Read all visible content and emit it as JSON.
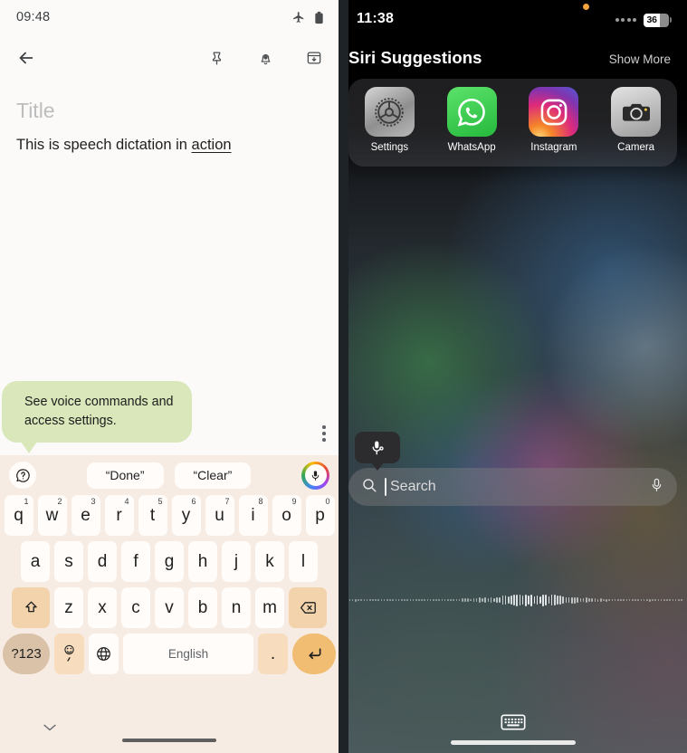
{
  "left": {
    "status": {
      "time": "09:48",
      "icons": [
        "airplane-mode-icon",
        "battery-icon"
      ]
    },
    "toolbar": {
      "back_label": "Back",
      "actions": [
        "pin-icon",
        "reminder-bell-icon",
        "archive-icon"
      ]
    },
    "note": {
      "title_placeholder": "Title",
      "body_prefix": "This is speech dictation in ",
      "body_dictated": "action"
    },
    "tooltip": {
      "text": "See voice commands and access settings."
    },
    "overflow_menu_label": "More options",
    "keyboard": {
      "help_icon": "help-speech-bubble-icon",
      "chips": [
        "“Done”",
        "“Clear”"
      ],
      "mic_icon": "microphone-icon",
      "row1": [
        {
          "k": "q",
          "n": "1"
        },
        {
          "k": "w",
          "n": "2"
        },
        {
          "k": "e",
          "n": "3"
        },
        {
          "k": "r",
          "n": "4"
        },
        {
          "k": "t",
          "n": "5"
        },
        {
          "k": "y",
          "n": "6"
        },
        {
          "k": "u",
          "n": "7"
        },
        {
          "k": "i",
          "n": "8"
        },
        {
          "k": "o",
          "n": "9"
        },
        {
          "k": "p",
          "n": "0"
        }
      ],
      "row2": [
        "a",
        "s",
        "d",
        "f",
        "g",
        "h",
        "j",
        "k",
        "l"
      ],
      "row3": [
        "z",
        "x",
        "c",
        "v",
        "b",
        "n",
        "m"
      ],
      "shift_label": "shift-icon",
      "backspace_label": "backspace-icon",
      "symbols_label": "?123",
      "emoji_label": "emoji-comma-key",
      "globe_label": "globe-language-icon",
      "space_label": "English",
      "period_label": ".",
      "enter_label": "enter-icon",
      "dismiss_label": "hide-keyboard-chevron"
    }
  },
  "right": {
    "status": {
      "time": "11:38",
      "battery_percent": "36",
      "signal_dots": 4,
      "privacy_dot": "mic-in-use-indicator"
    },
    "siri": {
      "title": "Siri Suggestions",
      "show_more": "Show More",
      "apps": [
        {
          "name": "Settings",
          "icon": "settings-gear-icon"
        },
        {
          "name": "WhatsApp",
          "icon": "whatsapp-icon"
        },
        {
          "name": "Instagram",
          "icon": "instagram-icon"
        },
        {
          "name": "Camera",
          "icon": "camera-icon"
        }
      ]
    },
    "mic_tooltip_icon": "dictation-settings-mic-icon",
    "search": {
      "placeholder": "Search",
      "value": "",
      "leading_icon": "search-icon",
      "trailing_icon": "microphone-icon"
    },
    "waveform_label": "audio-waveform",
    "keyboard_dismiss_icon": "keyboard-icon"
  },
  "colors": {
    "keyboard_bg": "#f7ece4",
    "key_bg": "#fffcf9",
    "key_mod_bg": "#f2d3ab",
    "key_enter_bg": "#f0bd72",
    "key_symbols_bg": "#d9c2a8",
    "tooltip_green": "#d9e7bb",
    "note_text": "#1f1f1f",
    "ios_dark": "#2c2c2e"
  }
}
